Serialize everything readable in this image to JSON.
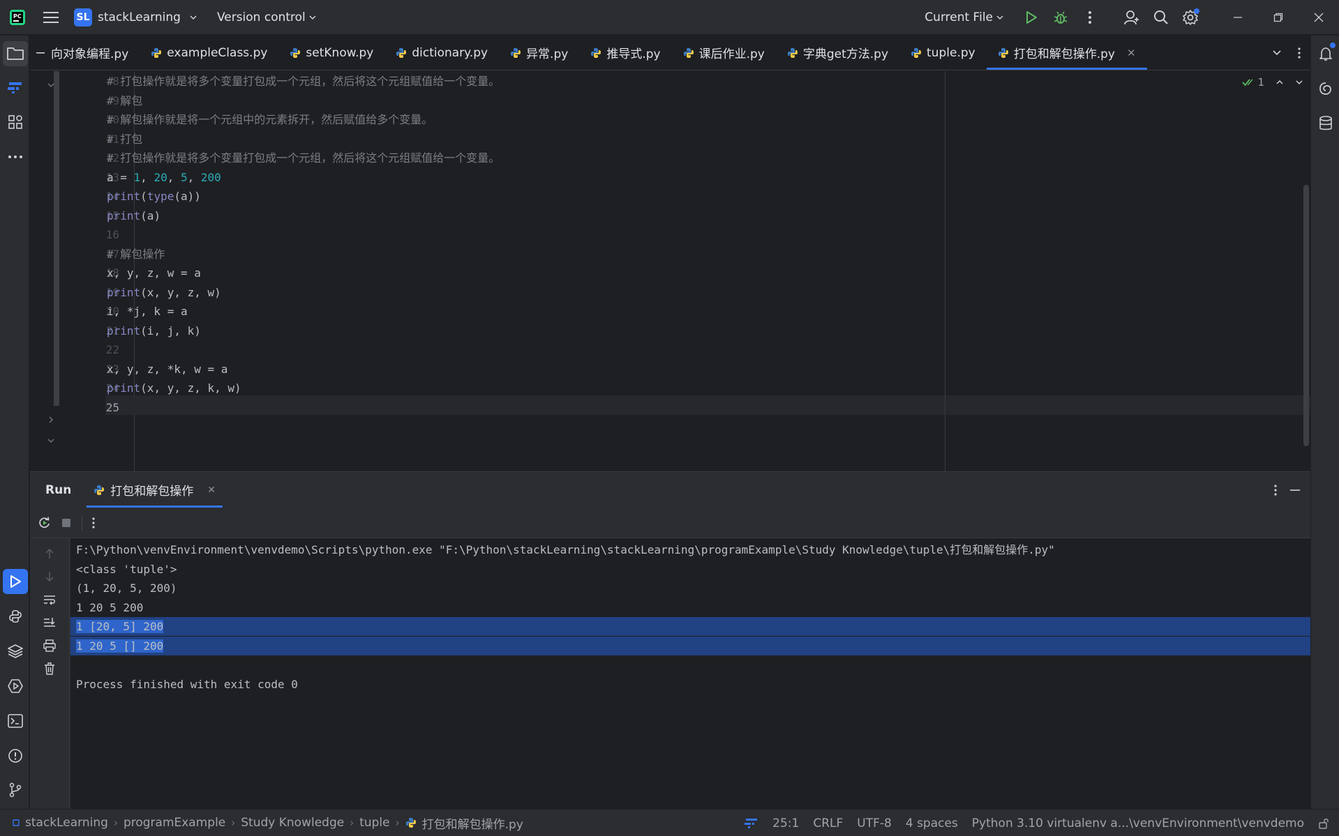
{
  "titlebar": {
    "project_badge": "SL",
    "project_name": "stackLearning",
    "version_control": "Version control",
    "run_config": "Current File"
  },
  "tabs": [
    {
      "label": "面向对象编程.py",
      "visible_label": "向对象编程.py",
      "active": false
    },
    {
      "label": "exampleClass.py",
      "active": false
    },
    {
      "label": "setKnow.py",
      "active": false
    },
    {
      "label": "dictionary.py",
      "active": false
    },
    {
      "label": "异常.py",
      "active": false
    },
    {
      "label": "推导式.py",
      "active": false
    },
    {
      "label": "课后作业.py",
      "active": false
    },
    {
      "label": "字典get方法.py",
      "active": false
    },
    {
      "label": "tuple.py",
      "active": false
    },
    {
      "label": "打包和解包操作.py",
      "active": true
    }
  ],
  "editor": {
    "inspection_count": "1",
    "lines": [
      {
        "n": "8",
        "text": "# 打包操作就是将多个变量打包成一个元组，然后将这个元组赋值给一个变量。"
      },
      {
        "n": "9",
        "text": "# 解包"
      },
      {
        "n": "10",
        "text": "# 解包操作就是将一个元组中的元素拆开，然后赋值给多个变量。"
      },
      {
        "n": "11",
        "text": "# 打包"
      },
      {
        "n": "12",
        "text": "# 打包操作就是将多个变量打包成一个元组，然后将这个元组赋值给一个变量。"
      },
      {
        "n": "13",
        "text": "a = 1, 20, 5, 200"
      },
      {
        "n": "14",
        "text": "print(type(a))"
      },
      {
        "n": "15",
        "text": "print(a)"
      },
      {
        "n": "16",
        "text": ""
      },
      {
        "n": "17",
        "text": "# 解包操作"
      },
      {
        "n": "18",
        "text": "x, y, z, w = a"
      },
      {
        "n": "19",
        "text": "print(x, y, z, w)"
      },
      {
        "n": "20",
        "text": "i, *j, k = a"
      },
      {
        "n": "21",
        "text": "print(i, j, k)"
      },
      {
        "n": "22",
        "text": ""
      },
      {
        "n": "23",
        "text": "x, y, z, *k, w = a"
      },
      {
        "n": "24",
        "text": "print(x, y, z, k, w)"
      },
      {
        "n": "25",
        "text": ""
      }
    ]
  },
  "run": {
    "title": "Run",
    "tab_label": "打包和解包操作",
    "output": [
      "F:\\Python\\venvEnvironment\\venvdemo\\Scripts\\python.exe \"F:\\Python\\stackLearning\\stackLearning\\programExample\\Study Knowledge\\tuple\\打包和解包操作.py\"",
      "<class 'tuple'>",
      "(1, 20, 5, 200)",
      "1 20 5 200",
      "1 [20, 5] 200",
      "1 20 5 [] 200",
      "",
      "Process finished with exit code 0"
    ],
    "selected_lines": [
      4,
      5
    ]
  },
  "statusbar": {
    "breadcrumbs": [
      "stackLearning",
      "programExample",
      "Study Knowledge",
      "tuple",
      "打包和解包操作.py"
    ],
    "position": "25:1",
    "line_sep": "CRLF",
    "encoding": "UTF-8",
    "indent": "4 spaces",
    "interpreter": "Python 3.10 virtualenv a...\\venvEnvironment\\venvdemo"
  },
  "colors": {
    "accent": "#3574f0",
    "selection": "#214283",
    "comment": "#7a7e85",
    "number": "#2aacb8",
    "builtin": "#8888c6",
    "run_green": "#5fb865"
  }
}
